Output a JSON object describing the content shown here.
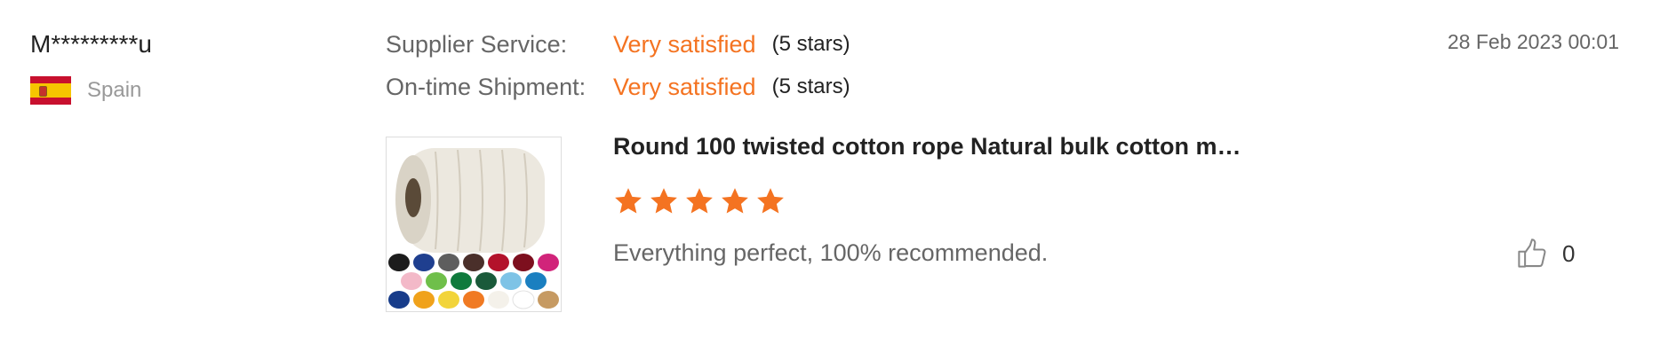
{
  "reviewer": {
    "name": "M*********u",
    "country": "Spain",
    "flag_icon": "spain-flag-icon"
  },
  "ratings": [
    {
      "label": "Supplier Service:",
      "value": "Very satisfied",
      "stars_text": "(5 stars)"
    },
    {
      "label": "On-time Shipment:",
      "value": "Very satisfied",
      "stars_text": "(5 stars)"
    }
  ],
  "date": "28 Feb 2023 00:01",
  "product": {
    "title": "Round 100 twisted cotton rope Natural bulk cotton m…",
    "rating": 5,
    "max_rating": 5,
    "star_icon": "star-icon"
  },
  "review_text": "Everything perfect, 100% recommended.",
  "helpful": {
    "icon": "thumbs-up-icon",
    "count": "0"
  },
  "colors": {
    "accent": "#f47321",
    "flag_red": "#c8102e",
    "flag_yellow": "#f6c500"
  }
}
